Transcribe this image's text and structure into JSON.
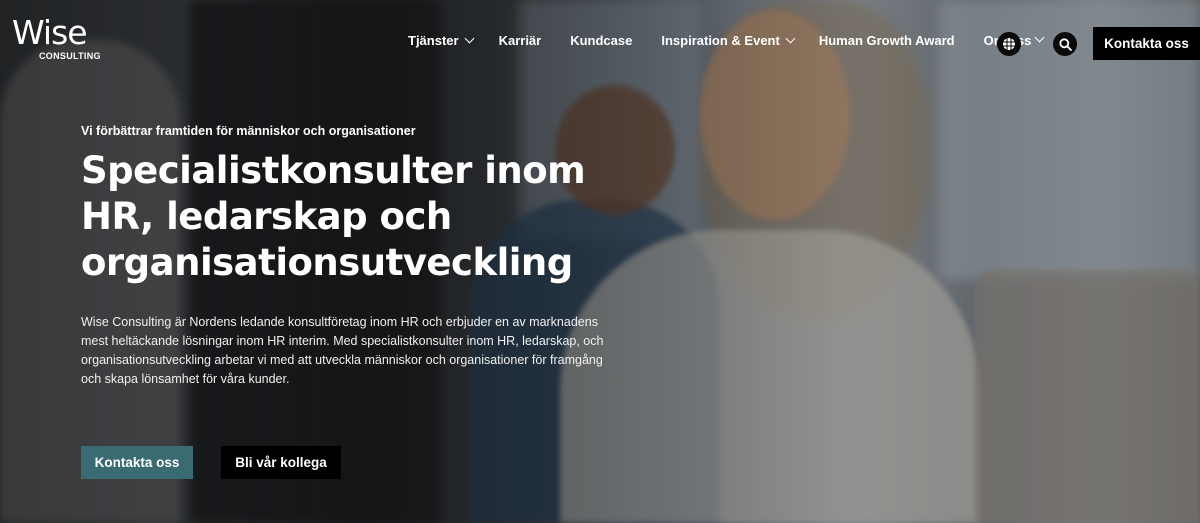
{
  "brand": {
    "name": "Wise",
    "sub": "CONSULTING"
  },
  "nav": {
    "items": [
      {
        "label": "Tjänster",
        "has_dropdown": true
      },
      {
        "label": "Karriär",
        "has_dropdown": false
      },
      {
        "label": "Kundcase",
        "has_dropdown": false
      },
      {
        "label": "Inspiration & Event",
        "has_dropdown": true
      },
      {
        "label": "Human Growth Award",
        "has_dropdown": false
      },
      {
        "label": "Om oss",
        "has_dropdown": false
      }
    ],
    "language_icon": "globe-icon",
    "search_icon": "search-icon",
    "cta_label": "Kontakta oss"
  },
  "hero": {
    "tagline": "Vi förbättrar framtiden för människor och organisationer",
    "headline_lines": [
      "Specialistkonsulter inom",
      "HR, ledarskap och",
      "organisationsutveckling"
    ],
    "body": "Wise Consulting är Nordens ledande konsultföretag inom HR och erbjuder en av marknadens mest heltäckande lösningar inom HR interim. Med specialistkonsulter inom HR, ledarskap, och organisationsutveckling arbetar vi med att utveckla människor och organisationer för framgång och skapa lönsamhet för våra kunder.",
    "primary_button": "Kontakta oss",
    "secondary_button": "Bli vår kollega"
  },
  "colors": {
    "accent_teal": "#3a6a72",
    "cta_black": "#000000"
  }
}
